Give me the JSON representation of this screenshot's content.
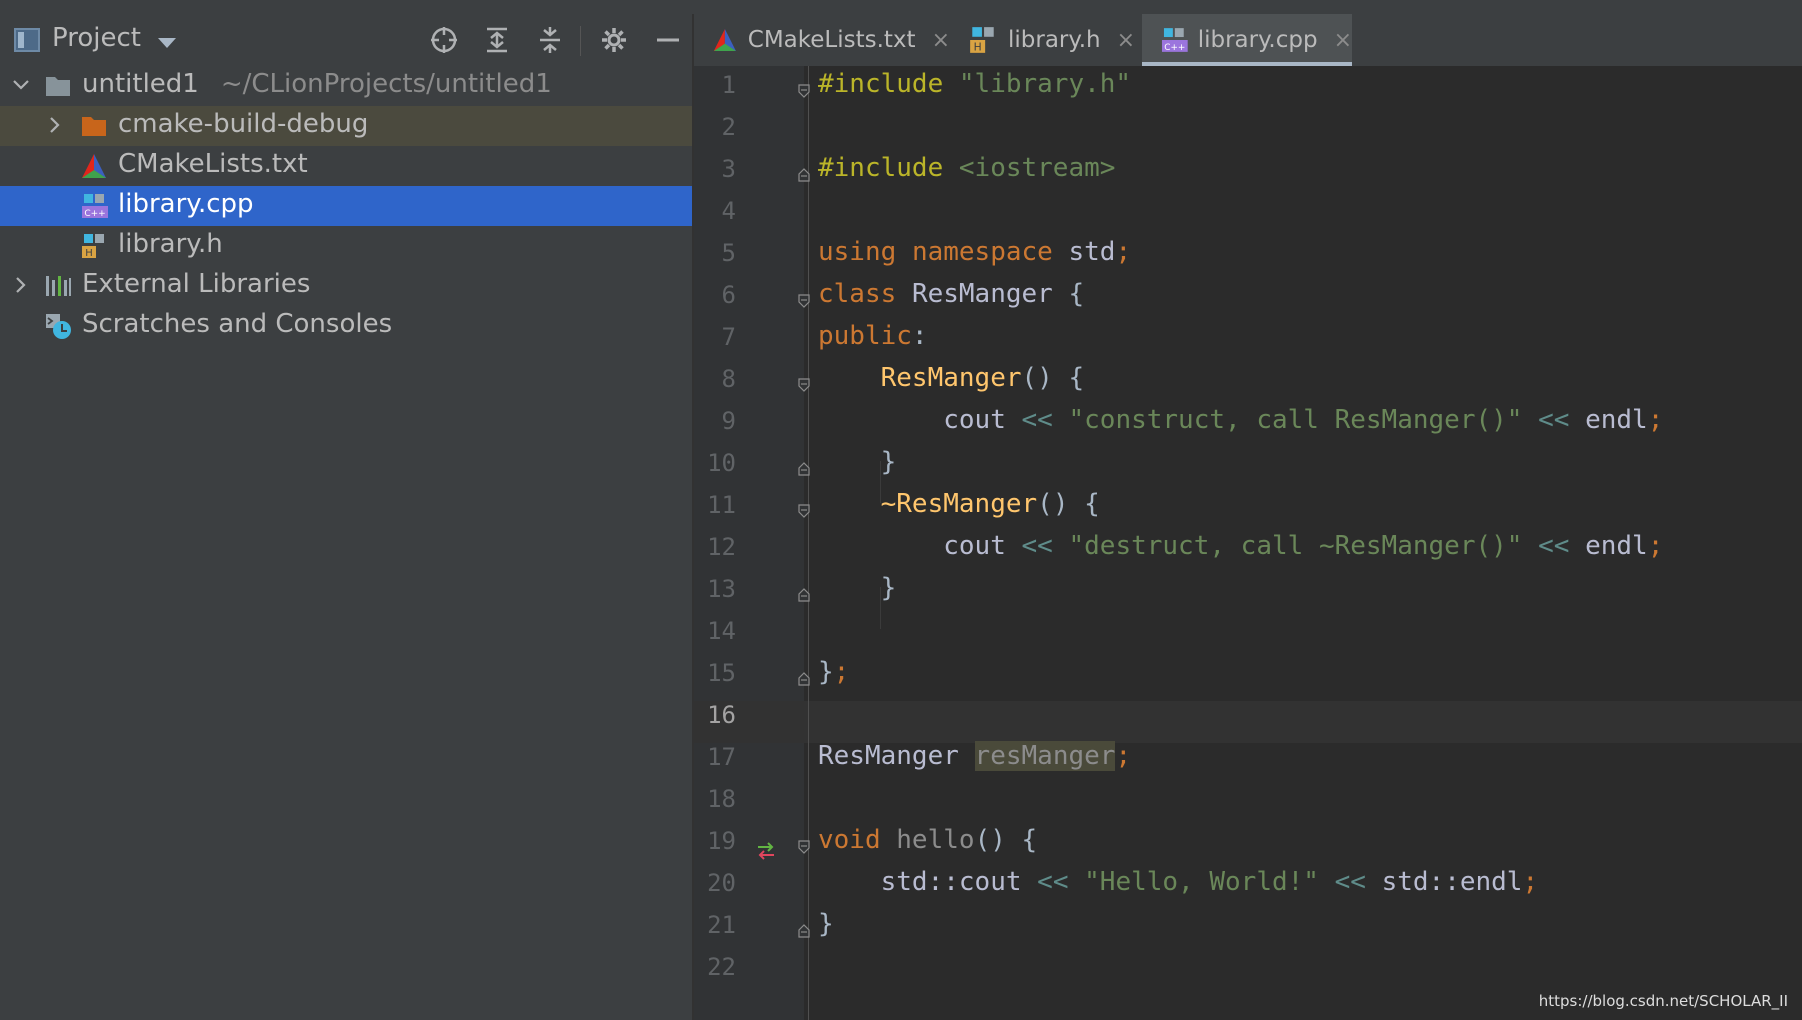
{
  "project_panel": {
    "title": "Project",
    "toolbar": [
      "locate-icon",
      "expand-all-icon",
      "collapse-all-icon",
      "gear-icon",
      "minimize-icon"
    ],
    "tree": [
      {
        "label": "untitled1",
        "path": "~/CLionProjects/untitled1",
        "icon": "folder-icon",
        "expanded": true
      },
      {
        "label": "cmake-build-debug",
        "icon": "folder-orange-icon",
        "expanded": false
      },
      {
        "label": "CMakeLists.txt",
        "icon": "cmake-icon"
      },
      {
        "label": "library.cpp",
        "icon": "cpp-file-icon",
        "selected": true
      },
      {
        "label": "library.h",
        "icon": "header-file-icon"
      },
      {
        "label": "External Libraries",
        "icon": "libraries-icon",
        "expanded": false
      },
      {
        "label": "Scratches and Consoles",
        "icon": "scratches-icon"
      }
    ]
  },
  "tabs": [
    {
      "label": "CMakeLists.txt",
      "icon": "cmake-icon",
      "close": "×"
    },
    {
      "label": "library.h",
      "icon": "header-file-icon",
      "close": "×"
    },
    {
      "label": "library.cpp",
      "icon": "cpp-file-icon",
      "close": "×",
      "active": true
    }
  ],
  "editor": {
    "current_line": 16,
    "line_numbers": [
      "1",
      "2",
      "3",
      "4",
      "5",
      "6",
      "7",
      "8",
      "9",
      "10",
      "11",
      "12",
      "13",
      "14",
      "15",
      "16",
      "17",
      "18",
      "19",
      "20",
      "21",
      "22"
    ],
    "code": {
      "l1_kw": "#include",
      "l1_str": "\"library.h\"",
      "l3_kw": "#include",
      "l3_str": "<iostream>",
      "l5_a": "using",
      "l5_b": "namespace",
      "l5_c": "std",
      "l5_d": ";",
      "l6_a": "class",
      "l6_b": "ResManger",
      "l6_c": "{",
      "l7_a": "public",
      "l7_b": ":",
      "l8_a": "ResManger",
      "l8_b": "() {",
      "l9_a": "cout",
      "l9_b": "<<",
      "l9_c": "\"construct, call ResManger()\"",
      "l9_d": "<<",
      "l9_e": "endl",
      "l9_f": ";",
      "l10": "}",
      "l11_a": "~ResManger",
      "l11_b": "() {",
      "l12_a": "cout",
      "l12_b": "<<",
      "l12_c": "\"destruct, call ~ResManger()\"",
      "l12_d": "<<",
      "l12_e": "endl",
      "l12_f": ";",
      "l13": "}",
      "l15_a": "}",
      "l15_b": ";",
      "l17_a": "ResManger",
      "l17_b": "resManger",
      "l17_c": ";",
      "l19_a": "void",
      "l19_b": "hello",
      "l19_c": "() {",
      "l20_a": "std::cout",
      "l20_b": "<<",
      "l20_c": "\"Hello, World!\"",
      "l20_d": "<<",
      "l20_e": "std::endl",
      "l20_f": ";",
      "l21": "}"
    }
  },
  "watermark": "https://blog.csdn.net/SCHOLAR_II",
  "colors": {
    "selection": "#2f65ca",
    "keyword": "#cc7832",
    "string": "#6a8759",
    "function": "#ffc66d",
    "preprocessor": "#bbb529"
  }
}
